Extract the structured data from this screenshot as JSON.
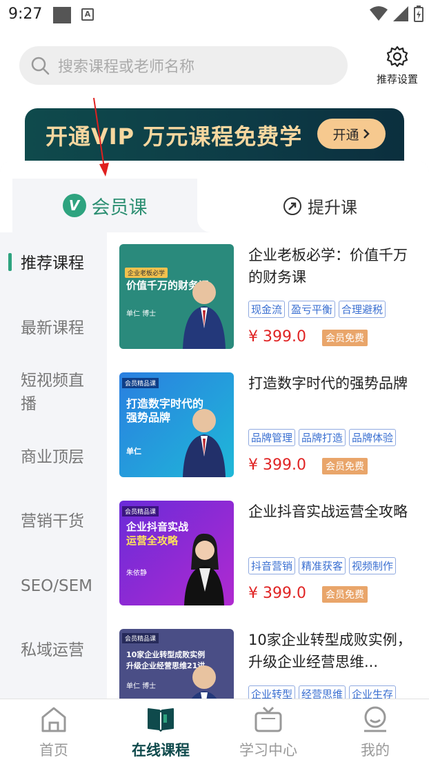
{
  "status_bar": {
    "time": "9:27",
    "a_label": "A"
  },
  "search": {
    "placeholder": "搜索课程或老师名称"
  },
  "settings": {
    "label": "推荐设置"
  },
  "banner": {
    "text": "开通VIP  万元课程免费学",
    "button_label": "开通"
  },
  "tabs": {
    "member": "会员课",
    "upgrade": "提升课"
  },
  "categories": [
    {
      "label": "推荐课程",
      "active": true
    },
    {
      "label": "最新课程",
      "active": false
    },
    {
      "label": "短视频直播",
      "active": false
    },
    {
      "label": "商业顶层",
      "active": false
    },
    {
      "label": "营销干货",
      "active": false
    },
    {
      "label": "SEO/SEM",
      "active": false
    },
    {
      "label": "私域运营",
      "active": false
    }
  ],
  "courses": [
    {
      "title": "企业老板必学：价值千万的财务课",
      "tags": [
        "现金流",
        "盈亏平衡",
        "合理避税"
      ],
      "price": "¥ 399.0",
      "badge": "会员免费",
      "thumb": {
        "line1": "价值千万的财务课",
        "name": "单仁 博士",
        "top_tag": "企业老板必学"
      }
    },
    {
      "title": "打造数字时代的强势品牌",
      "tags": [
        "品牌管理",
        "品牌打造",
        "品牌体验"
      ],
      "price": "¥ 399.0",
      "badge": "会员免费",
      "thumb": {
        "line1": "打造数字时代的",
        "line2": "强势品牌",
        "name": "单仁",
        "top_tag": "会员精品课"
      }
    },
    {
      "title": "企业抖音实战运营全攻略",
      "tags": [
        "抖音营销",
        "精准获客",
        "视频制作"
      ],
      "price": "¥ 399.0",
      "badge": "会员免费",
      "thumb": {
        "line1": "企业抖音实战",
        "line2": "运营全攻略",
        "name": "朱依静",
        "top_tag": "会员精品课"
      }
    },
    {
      "title": "10家企业转型成败实例，升级企业经营思维...",
      "tags": [
        "企业转型",
        "经营思维",
        "企业生存"
      ],
      "price": "",
      "badge": "",
      "thumb": {
        "line1": "10家企业转型成败实例",
        "line2": "升级企业经营思维21讲",
        "name": "单仁 博士",
        "top_tag": "会员精品课"
      }
    }
  ],
  "bottom_nav": [
    {
      "label": "首页",
      "icon": "home-icon",
      "active": false
    },
    {
      "label": "在线课程",
      "icon": "book-icon",
      "active": true
    },
    {
      "label": "学习中心",
      "icon": "tv-icon",
      "active": false
    },
    {
      "label": "我的",
      "icon": "profile-icon",
      "active": false
    }
  ],
  "colors": {
    "brand_green": "#2ea37f",
    "banner_dark": "#0f4a4c",
    "banner_gold": "#f7d79f",
    "price_red": "#e02424",
    "tag_blue": "#3a6fd1"
  }
}
